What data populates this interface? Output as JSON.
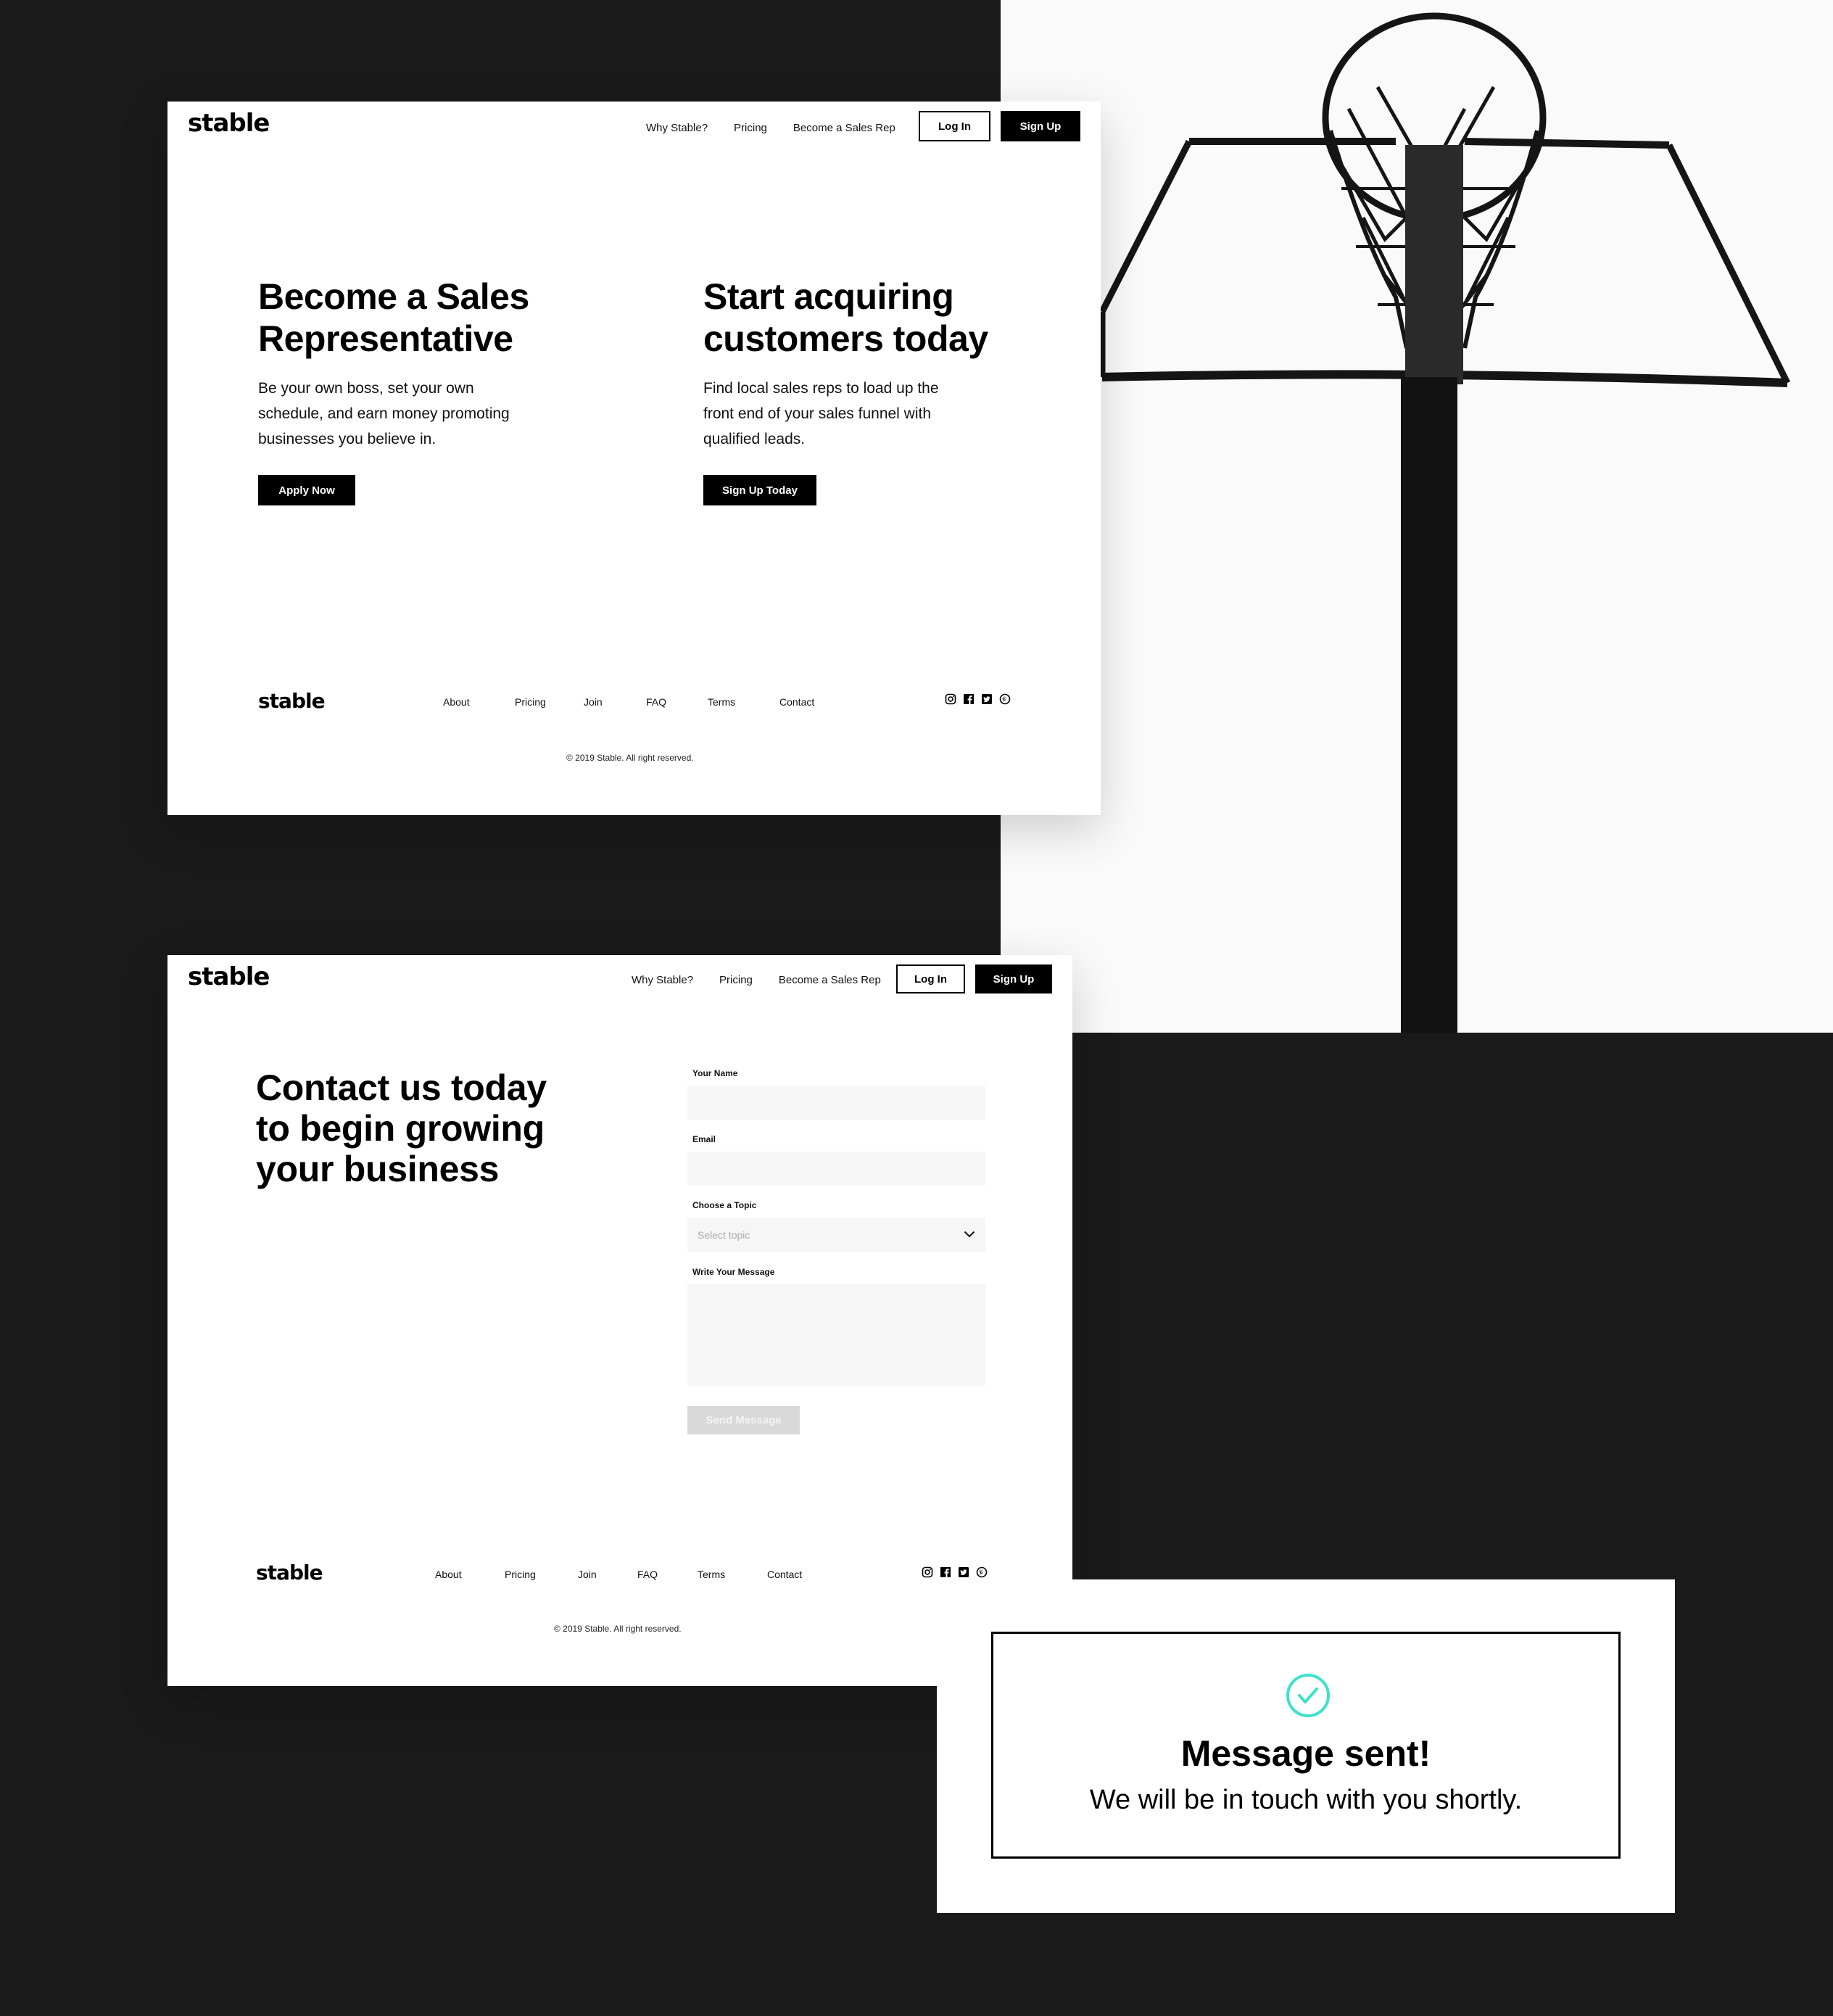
{
  "brand": {
    "name": "stable",
    "accent_color": "#3ee0cc"
  },
  "nav": {
    "links": [
      "Why Stable?",
      "Pricing",
      "Become a Sales Rep"
    ],
    "login_label": "Log In",
    "signup_label": "Sign Up"
  },
  "landing": {
    "left": {
      "title_line1": "Become a Sales",
      "title_line2": "Representative",
      "text_line1": "Be your own boss, set your own",
      "text_line2": "schedule, and earn money promoting",
      "text_line3": "businesses you believe in.",
      "cta": "Apply Now"
    },
    "right": {
      "title_line1": "Start acquiring",
      "title_line2": "customers today",
      "text_line1": "Find local sales reps to load up the",
      "text_line2": "front end of your sales funnel with",
      "text_line3": "qualified leads.",
      "cta": "Sign Up Today"
    }
  },
  "contact": {
    "title_line1": "Contact us today",
    "title_line2": "to begin growing",
    "title_line3": "your business",
    "form": {
      "name_label": "Your Name",
      "name_value": "",
      "email_label": "Email",
      "email_value": "",
      "topic_label": "Choose a Topic",
      "topic_placeholder": "Select topic",
      "message_label": "Write Your Message",
      "message_value": "",
      "submit_label": "Send Message"
    }
  },
  "footer": {
    "links": [
      "About",
      "Pricing",
      "Join",
      "FAQ",
      "Terms",
      "Contact"
    ],
    "social": [
      "instagram-icon",
      "facebook-icon",
      "twitter-icon",
      "pinterest-icon"
    ],
    "copyright": "© 2019 Stable. All right reserved."
  },
  "confirmation": {
    "icon": "check-circle-icon",
    "title": "Message sent!",
    "subtitle": "We will be in touch with you shortly."
  }
}
